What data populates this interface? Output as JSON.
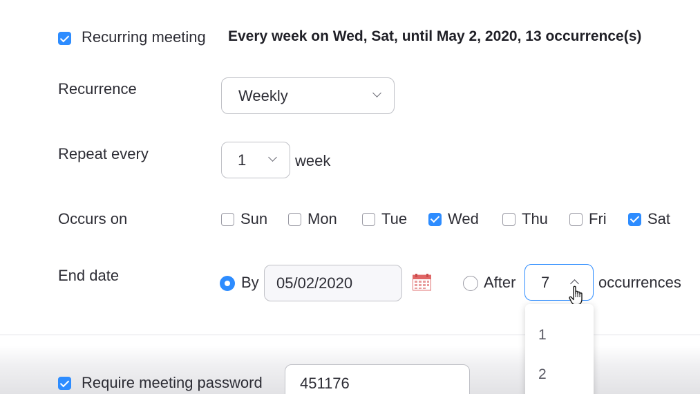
{
  "recurring": {
    "checked": true,
    "label": "Recurring meeting",
    "summary": "Every week on Wed, Sat, until May 2, 2020, 13 occurrence(s)"
  },
  "recurrence": {
    "label": "Recurrence",
    "value": "Weekly"
  },
  "repeat": {
    "label": "Repeat every",
    "value": "1",
    "unit": "week"
  },
  "occurs": {
    "label": "Occurs on",
    "days": [
      {
        "label": "Sun",
        "checked": false
      },
      {
        "label": "Mon",
        "checked": false
      },
      {
        "label": "Tue",
        "checked": false
      },
      {
        "label": "Wed",
        "checked": true
      },
      {
        "label": "Thu",
        "checked": false
      },
      {
        "label": "Fri",
        "checked": false
      },
      {
        "label": "Sat",
        "checked": true
      }
    ]
  },
  "end_date": {
    "label": "End date",
    "by_label": "By",
    "by_selected": true,
    "date_value": "05/02/2020",
    "after_label": "After",
    "after_selected": false,
    "occurrences_value": "7",
    "occurrences_label": "occurrences",
    "dropdown_options": [
      "1",
      "2"
    ]
  },
  "password": {
    "checked": true,
    "label": "Require meeting password",
    "value": "451176"
  },
  "colors": {
    "accent": "#2d8cff",
    "focus_border": "#2d8cff"
  }
}
